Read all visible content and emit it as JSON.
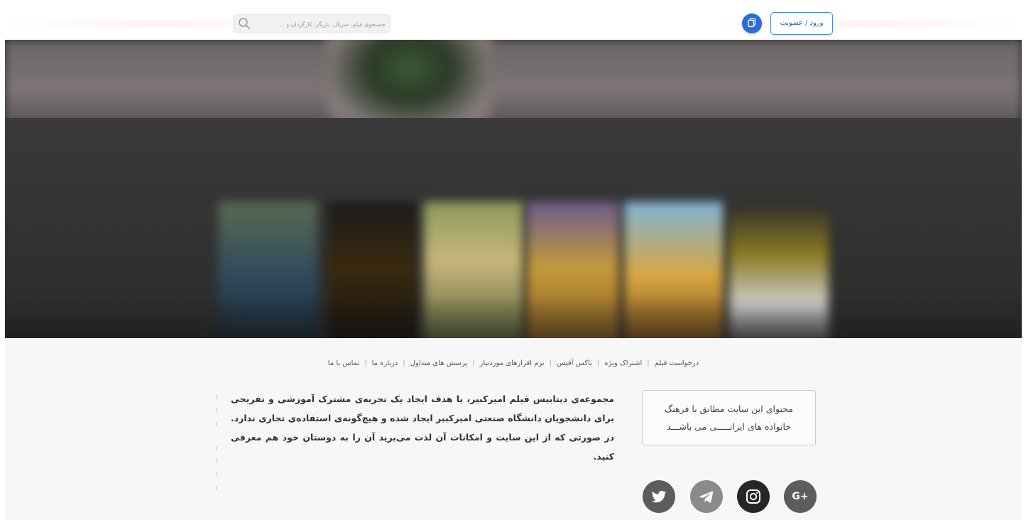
{
  "header": {
    "search": {
      "placeholder": "جستجوی فیلم، سریال، بازیگر، کارگردان و ..."
    },
    "login_label": "ورود / عضویت",
    "cart_icon": "document-copy-icon"
  },
  "footer": {
    "nav": [
      {
        "label": "درخواست فیلم"
      },
      {
        "label": "اشتراک ویژه"
      },
      {
        "label": "باکس آفیس"
      },
      {
        "label": "نرم افزارهای موردنیاز"
      },
      {
        "label": "پرسش های متداول"
      },
      {
        "label": "درباره ما"
      },
      {
        "label": "تماس با ما"
      }
    ],
    "separator": "|",
    "about_text": "مجموعه‌ی دیتابیس فیلم امیرکبیر، با هدف ایجاد یک تجربه‌ی مشترک آموزشی و تفریحی برای دانشجویان دانشگاه صنعتی امیرکبیر ایجاد شده و هیچ‌گونه‌ی استفاده‌ی تجاری ندارد. در صورتی که از این سایت و امکانات آن لذت می‌برید آن را به دوستان خود هم معرفی کنید.",
    "notice_line1": "محتوای این سایت مطابق با فرهنگ",
    "notice_line2": "خانواده های ایرانـــــی می باشـــد",
    "social": [
      {
        "name": "twitter-icon"
      },
      {
        "name": "telegram-icon"
      },
      {
        "name": "instagram-icon"
      },
      {
        "name": "google-plus-icon",
        "label": "G+"
      }
    ]
  },
  "colors": {
    "accent": "#2b6cd6",
    "login_border": "#4a86e8",
    "footer_bg": "#f7f7f7",
    "hero_bg": "#2d2d2d"
  }
}
